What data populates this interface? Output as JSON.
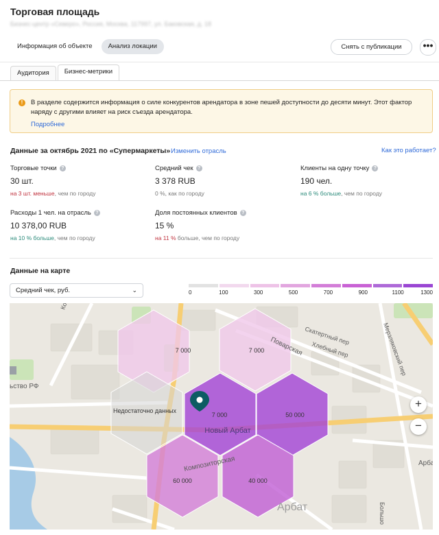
{
  "header": {
    "title": "Торговая площадь",
    "address": "Бизнес-центр «Северо», Россия, Москва, 117997, ул. Баковская, д. 18"
  },
  "top_tabs": [
    {
      "label": "Информация об объекте",
      "active": false
    },
    {
      "label": "Анализ локации",
      "active": true
    }
  ],
  "actions": {
    "unpublish_label": "Снять с публикации",
    "more_label": "•••"
  },
  "sub_tabs": [
    {
      "label": "Аудитория",
      "active": false
    },
    {
      "label": "Бизнес-метрики",
      "active": true
    }
  ],
  "alert": {
    "icon": "!",
    "text": "В разделе содержится информация о силе конкурентов арендатора в зоне пешей доступности до десяти минут. Этот фактор наряду с другими влияет на риск съезда арендатора.",
    "link": "Подробнее"
  },
  "section": {
    "title": "Данные за октябрь 2021 по «Супермаркеты»",
    "change_link": "Изменить отрасль",
    "how_link": "Как это работает?"
  },
  "metrics": [
    {
      "label": "Торговые точки",
      "value": "30 шт.",
      "delta": "на 3 шт. меньше",
      "delta_color": "red",
      "suffix": ", чем по городу"
    },
    {
      "label": "Средний чек",
      "value": "3 378 RUB",
      "delta": "0 %",
      "delta_color": "gray",
      "suffix": ", как по городу"
    },
    {
      "label": "Клиенты на одну точку",
      "value": "190 чел.",
      "delta": "на 6 % больше",
      "delta_color": "green",
      "suffix": ", чем по городу"
    },
    {
      "label": "Расходы 1 чел. на отрасль",
      "value": "10 378,00 RUB",
      "delta": "на 10 % больше",
      "delta_color": "green",
      "suffix": ", чем по городу"
    },
    {
      "label": "Доля постоянных клиентов",
      "value": "15 %",
      "delta": "на 11 %",
      "delta_color": "red",
      "suffix": " больше, чем по городу"
    }
  ],
  "map_section": {
    "title": "Данные на карте",
    "select_value": "Средний чек, руб."
  },
  "legend": {
    "ticks": [
      "0",
      "100",
      "300",
      "500",
      "700",
      "900",
      "1100",
      "1300"
    ],
    "colors": [
      "#e2e2e2",
      "#f2d9ee",
      "#eec3e7",
      "#e2a6df",
      "#d37ed8",
      "#c962d5",
      "#ae6ad8",
      "#9a46d3"
    ]
  },
  "map": {
    "hexes": [
      {
        "value": "7 000",
        "color": "#f0c8ea"
      },
      {
        "value": "7 000",
        "color": "#f0c8ea"
      },
      {
        "value": "Недостаточно данных",
        "color": "#d6d6d6"
      },
      {
        "value": "7 000",
        "color": "#a342d6"
      },
      {
        "value": "50 000",
        "color": "#a342d6"
      },
      {
        "value": "60 000",
        "color": "#d37ed8"
      },
      {
        "value": "40 000",
        "color": "#c05ed4"
      }
    ],
    "street_labels": [
      "Новый Арбат",
      "Композиторская",
      "Поварская",
      "Скатертный пер",
      "Хлебный пер",
      "Мерзляковский пер",
      "Арбат",
      "Большо",
      "Арба",
      "Конюшко",
      "ьство РФ"
    ],
    "zoom_in": "+",
    "zoom_out": "−"
  }
}
